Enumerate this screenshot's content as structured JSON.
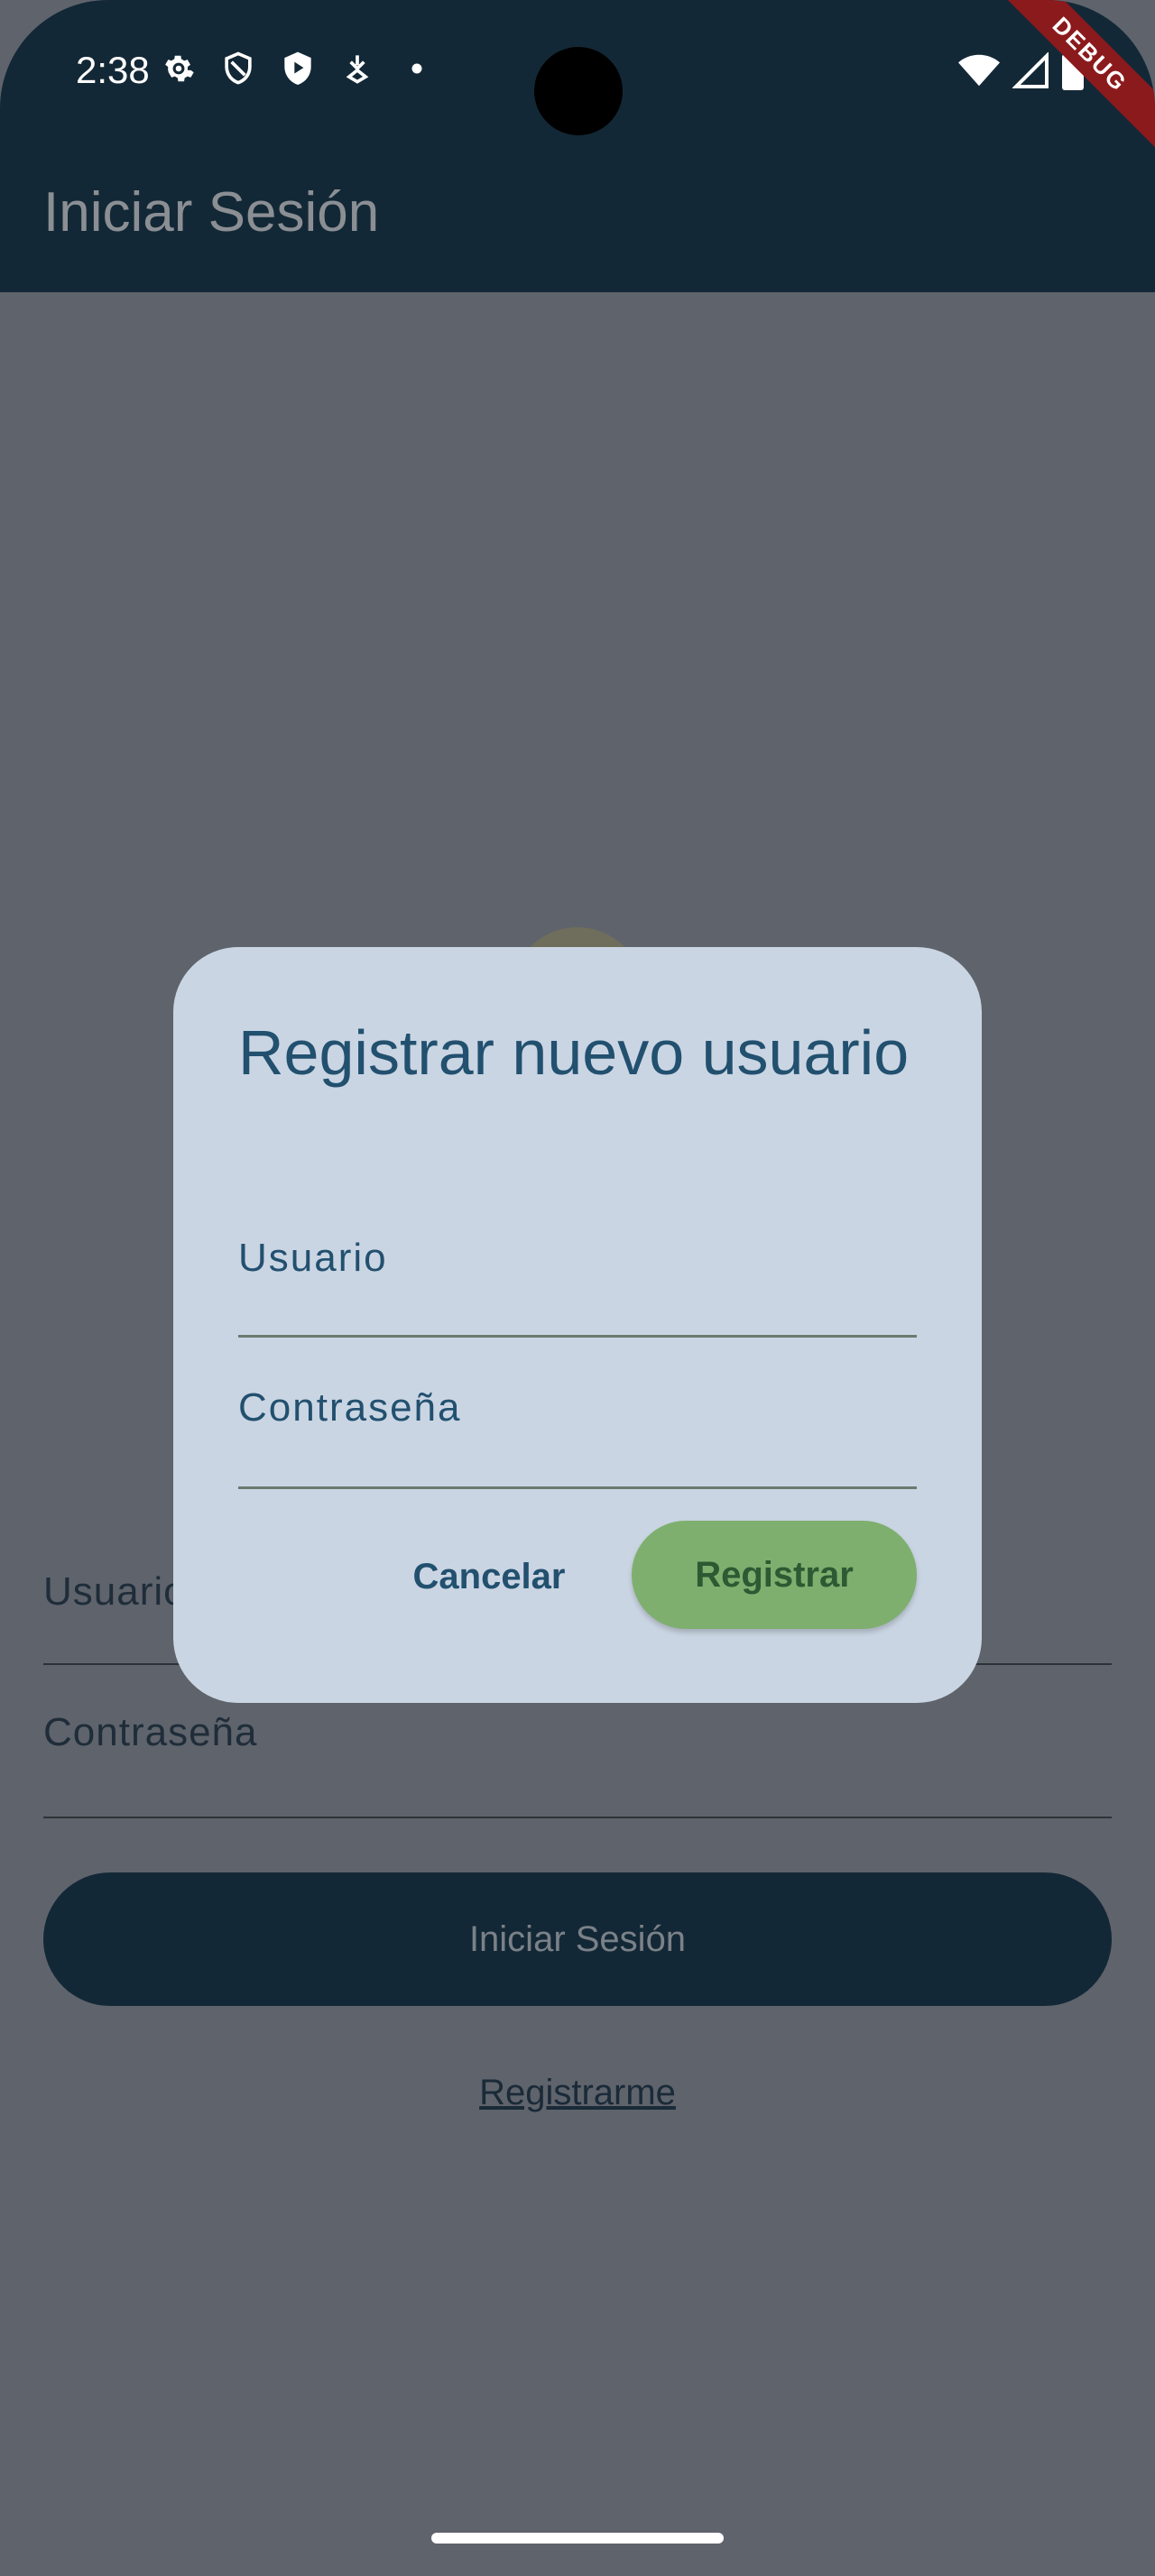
{
  "status_bar": {
    "time": "2:38",
    "left_icons": [
      "gear-icon",
      "shield-outline-icon",
      "shield-play-icon",
      "download-icon",
      "dot-icon"
    ],
    "right_icons": [
      "wifi-icon",
      "signal-icon",
      "battery-icon"
    ],
    "debug_label": "DEBUG"
  },
  "app_bar": {
    "title": "Iniciar Sesión"
  },
  "login_form": {
    "user_label": "Usuario",
    "password_label": "Contraseña",
    "login_button": "Iniciar Sesión",
    "register_link": "Registrarme"
  },
  "dialog": {
    "title": "Registrar nuevo usuario",
    "user_label": "Usuario",
    "password_label": "Contraseña",
    "cancel_button": "Cancelar",
    "register_button": "Registrar"
  },
  "colors": {
    "app_bar": "#132836",
    "scrim": "#5f636b",
    "dialog_bg": "#cad5e3",
    "dialog_text": "#22506f",
    "register_button": "#7faf6e",
    "debug_ribbon": "#8b1a1c"
  }
}
